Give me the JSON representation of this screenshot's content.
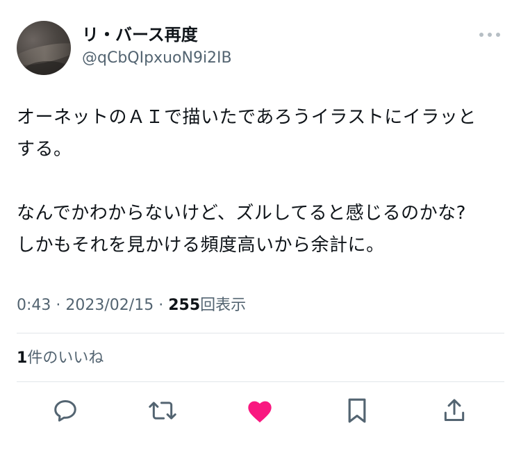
{
  "user": {
    "display_name": "リ・バース再度",
    "handle": "@qCbQIpxuoN9i2IB"
  },
  "tweet": {
    "paragraphs": [
      [
        "オーネットのＡＩで描いたであろうイラストにイラッと",
        "する。"
      ],
      [
        "なんでかわからないけど、ズルしてると感じるのかな?",
        "しかもそれを見かける頻度高いから余計に。"
      ]
    ]
  },
  "meta": {
    "time": "0:43",
    "sep1": "·",
    "date": "2023/02/15",
    "sep2": "·",
    "views_count": "255",
    "views_label": "回表示"
  },
  "likes": {
    "count": "1",
    "label": "件のいいね"
  },
  "actions": {
    "reply_icon": "reply-icon",
    "retweet_icon": "retweet-icon",
    "like_icon": "heart-icon",
    "bookmark_icon": "bookmark-icon",
    "share_icon": "share-icon"
  },
  "colors": {
    "text_primary": "#0f1419",
    "text_secondary": "#536471",
    "icon": "#536471",
    "like_active": "#f91880",
    "divider": "#e1e6ea"
  }
}
